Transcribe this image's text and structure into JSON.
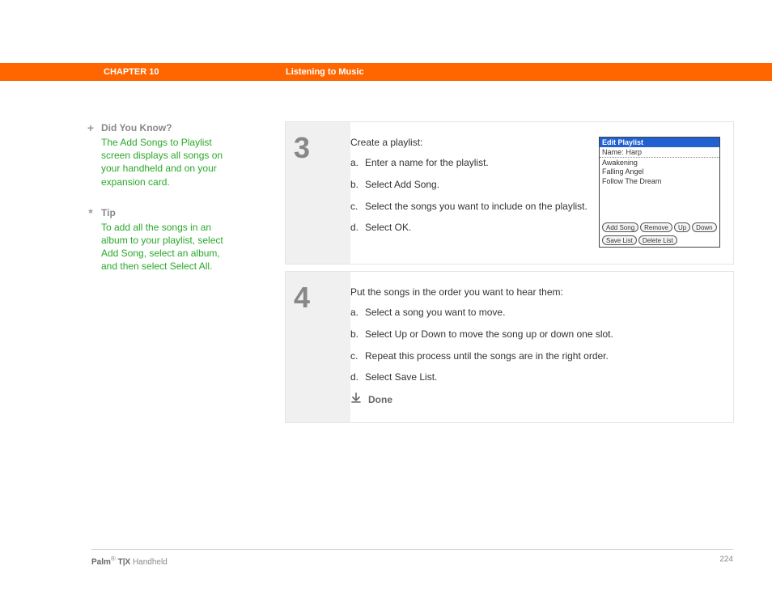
{
  "header": {
    "chapter": "CHAPTER 10",
    "title": "Listening to Music"
  },
  "sidebar": {
    "notes": [
      {
        "icon": "+",
        "heading": "Did You Know?",
        "body": "The Add Songs to Playlist screen displays all songs on your handheld and on your expansion card."
      },
      {
        "icon": "*",
        "heading": "Tip",
        "body": "To add all the songs in an album to your playlist, select Add Song, select an album, and then select Select All."
      }
    ]
  },
  "steps": [
    {
      "num": "3",
      "intro": "Create a playlist:",
      "items": [
        {
          "label": "a.",
          "text": "Enter a name for the playlist."
        },
        {
          "label": "b.",
          "text": "Select Add Song."
        },
        {
          "label": "c.",
          "text": "Select the songs you want to include on the playlist."
        },
        {
          "label": "d.",
          "text": "Select OK."
        }
      ],
      "device": {
        "title": "Edit Playlist",
        "name_label": "Name:",
        "name_value": "Harp",
        "songs": [
          "Awakening",
          "Falling Angel",
          "Follow The Dream"
        ],
        "row1": [
          "Add Song",
          "Remove",
          "Up",
          "Down"
        ],
        "row2": [
          "Save List",
          "Delete List"
        ]
      }
    },
    {
      "num": "4",
      "intro": "Put the songs in the order you want to hear them:",
      "items": [
        {
          "label": "a.",
          "text": "Select a song you want to move."
        },
        {
          "label": "b.",
          "text": "Select Up or Down to move the song up or down one slot."
        },
        {
          "label": "c.",
          "text": "Repeat this process until the songs are in the right order."
        },
        {
          "label": "d.",
          "text": "Select Save List."
        }
      ],
      "done": "Done"
    }
  ],
  "footer": {
    "product_bold": "Palm",
    "reg": "®",
    "product_model": " T|X",
    "product_rest": " Handheld",
    "page": "224"
  }
}
